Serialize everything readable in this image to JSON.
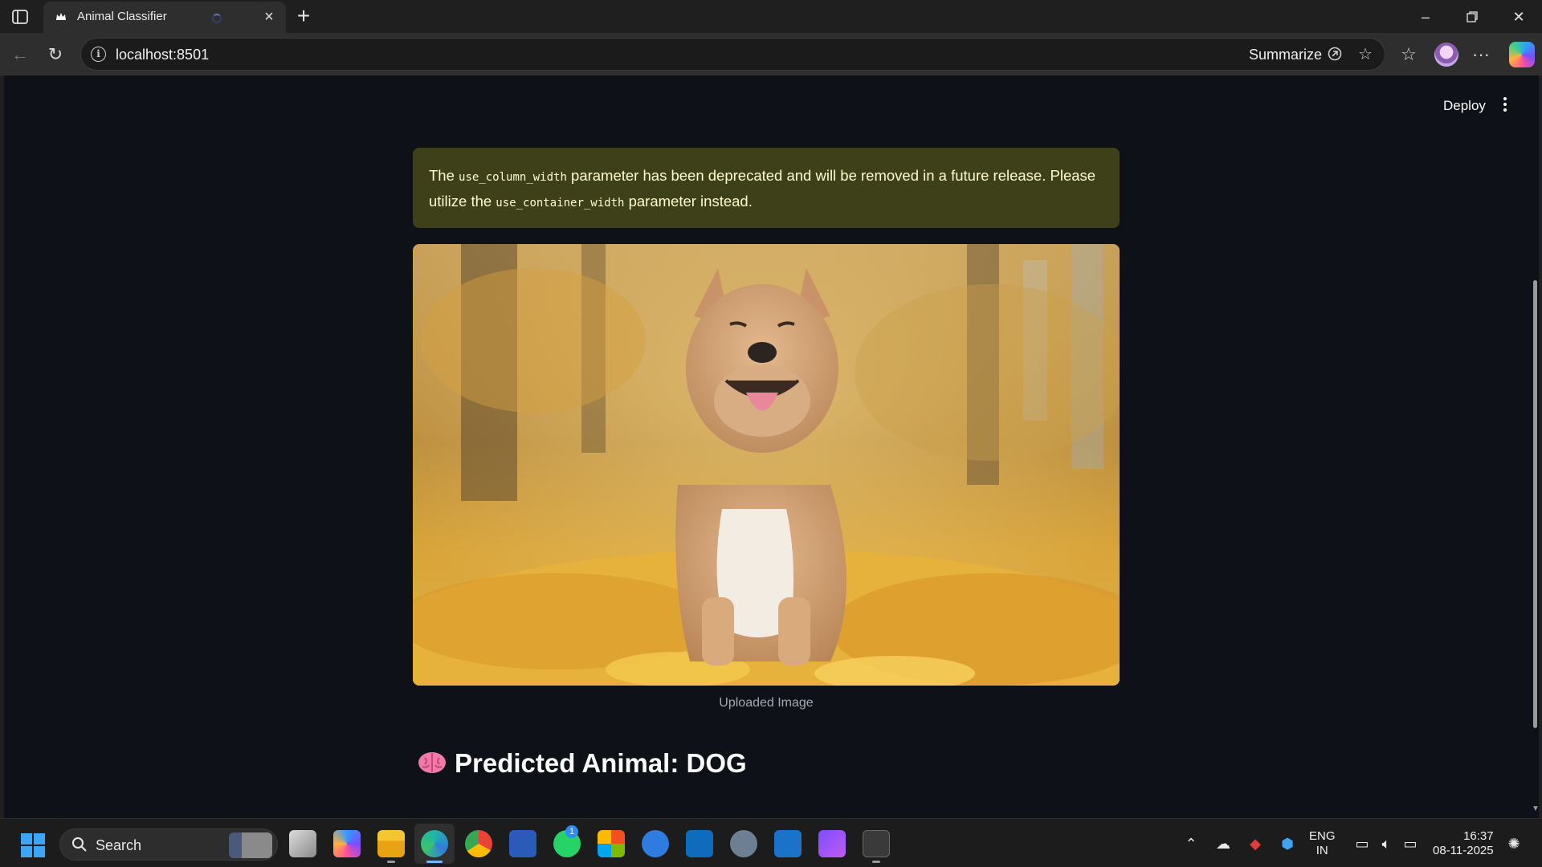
{
  "browser": {
    "tab_title": "Animal Classifier",
    "url": "localhost:8501",
    "summarize_label": "Summarize"
  },
  "app": {
    "deploy_label": "Deploy",
    "warning": {
      "part1": "The ",
      "code1": "use_column_width",
      "part2": " parameter has been deprecated and will be removed in a future release. Please utilize the ",
      "code2": "use_container_width",
      "part3": " parameter instead."
    },
    "image_caption": "Uploaded Image",
    "prediction_text": "Predicted Animal: DOG"
  },
  "taskbar": {
    "search_label": "Search",
    "whatsapp_badge": "1",
    "lang_line1": "ENG",
    "lang_line2": "IN",
    "time": "16:37",
    "date": "08-11-2025"
  },
  "icons": {
    "tab_favicon": "streamlit-crown-icon",
    "brain": "brain-icon"
  },
  "colors": {
    "page_bg": "#0e1117",
    "warning_bg": "#3e4019",
    "warning_text": "#fffbd0",
    "caption": "#a3a8b4"
  }
}
